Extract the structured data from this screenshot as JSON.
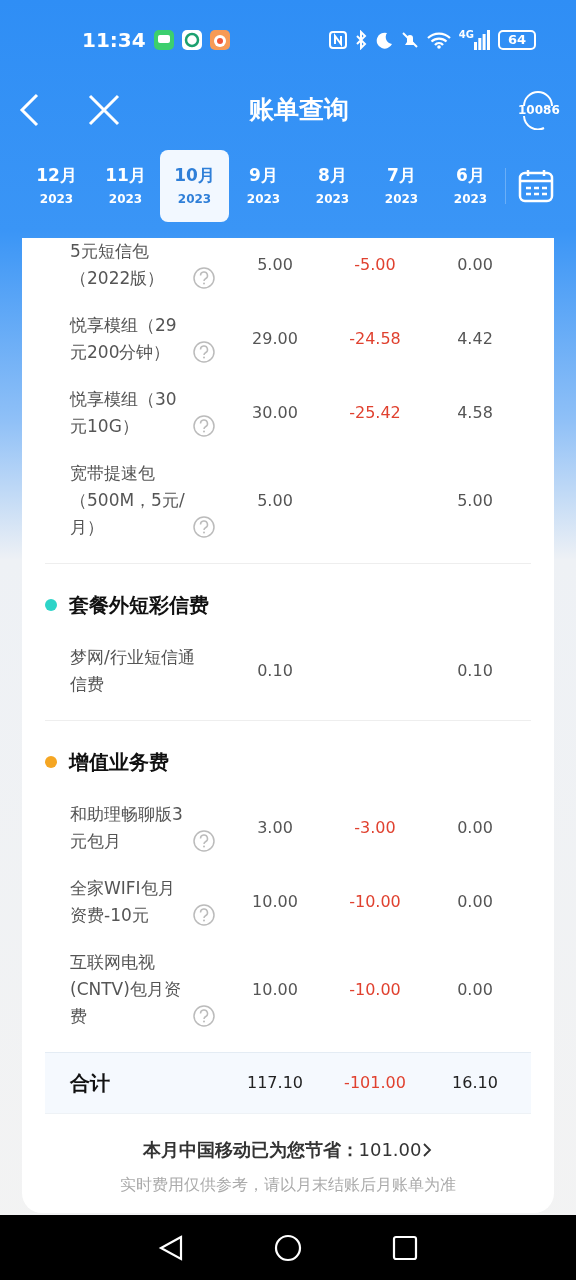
{
  "status_bar": {
    "time": "11:34",
    "network": "4G",
    "battery": "64"
  },
  "header": {
    "title": "账单查询",
    "service_label": "10086"
  },
  "months": [
    {
      "month": "12月",
      "year": "2023",
      "selected": false
    },
    {
      "month": "11月",
      "year": "2023",
      "selected": false
    },
    {
      "month": "10月",
      "year": "2023",
      "selected": true
    },
    {
      "month": "9月",
      "year": "2023",
      "selected": false
    },
    {
      "month": "8月",
      "year": "2023",
      "selected": false
    },
    {
      "month": "7月",
      "year": "2023",
      "selected": false
    },
    {
      "month": "6月",
      "year": "2023",
      "selected": false
    }
  ],
  "sections": [
    {
      "items": [
        {
          "name": "5元短信包（2022版）",
          "help": true,
          "amount": "5.00",
          "discount": "-5.00",
          "due": "0.00"
        },
        {
          "name": "悦享模组（29元200分钟）",
          "help": true,
          "amount": "29.00",
          "discount": "-24.58",
          "due": "4.42"
        },
        {
          "name": "悦享模组（30元10G）",
          "help": true,
          "amount": "30.00",
          "discount": "-25.42",
          "due": "4.58"
        },
        {
          "name": "宽带提速包（500M，5元/月）",
          "help": true,
          "amount": "5.00",
          "due": "5.00"
        }
      ]
    },
    {
      "title": "套餐外短彩信费",
      "color": "#2dd4c8",
      "items": [
        {
          "name": "梦网/行业短信通信费",
          "amount": "0.10",
          "due": "0.10"
        }
      ]
    },
    {
      "title": "增值业务费",
      "color": "#f5a623",
      "items": [
        {
          "name": "和助理畅聊版3元包月",
          "help": true,
          "amount": "3.00",
          "discount": "-3.00",
          "due": "0.00"
        },
        {
          "name": "全家WIFI包月资费-10元",
          "help": true,
          "amount": "10.00",
          "discount": "-10.00",
          "due": "0.00"
        },
        {
          "name": "互联网电视(CNTV)包月资费",
          "help": true,
          "amount": "10.00",
          "discount": "-10.00",
          "due": "0.00"
        }
      ]
    }
  ],
  "total": {
    "label": "合计",
    "amount": "117.10",
    "discount": "-101.00",
    "due": "16.10"
  },
  "savings": {
    "label": "本月中国移动已为您节省：",
    "value": "101.00"
  },
  "note": "实时费用仅供参考，请以月末结账后月账单为准"
}
